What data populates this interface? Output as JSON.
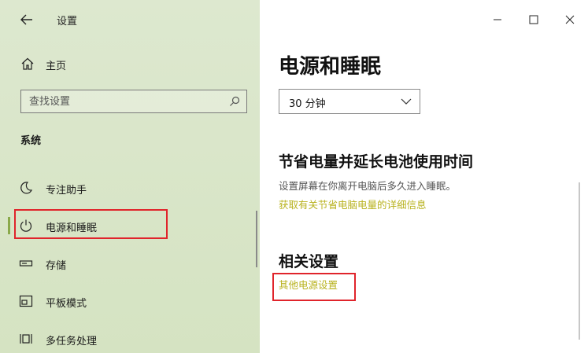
{
  "app_title": "设置",
  "sidebar": {
    "home_label": "主页",
    "search_placeholder": "查找设置",
    "section_title": "系统",
    "items": [
      {
        "label": "专注助手",
        "icon": "moon-icon"
      },
      {
        "label": "电源和睡眠",
        "icon": "power-icon",
        "selected": true
      },
      {
        "label": "存储",
        "icon": "storage-icon"
      },
      {
        "label": "平板模式",
        "icon": "tablet-mode-icon"
      },
      {
        "label": "多任务处理",
        "icon": "multitasking-icon"
      }
    ]
  },
  "main": {
    "title": "电源和睡眠",
    "dropdown_value": "30 分钟",
    "battery_heading": "节省电量并延长电池使用时间",
    "battery_desc": "设置屏幕在你离开电脑后多久进入睡眠。",
    "battery_link": "获取有关节省电脑电量的详细信息",
    "related_heading": "相关设置",
    "related_link": "其他电源设置"
  },
  "colors": {
    "accent": "#b8b21e",
    "highlight": "#e0242b",
    "selection_indicator": "#8aa94a"
  }
}
